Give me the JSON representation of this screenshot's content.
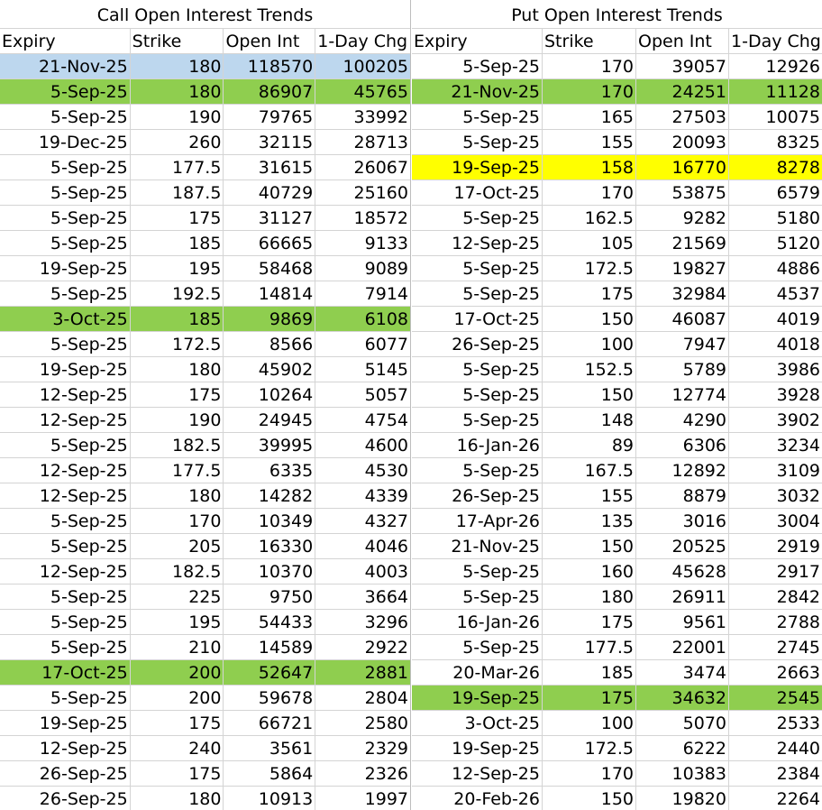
{
  "call": {
    "title": "Call Open Interest Trends",
    "headers": [
      "Expiry",
      "Strike",
      "Open Int",
      "1-Day Chg"
    ],
    "rows": [
      {
        "cells": [
          "21-Nov-25",
          "180",
          "118570",
          "100205"
        ],
        "hl": "blue"
      },
      {
        "cells": [
          "5-Sep-25",
          "180",
          "86907",
          "45765"
        ],
        "hl": "green"
      },
      {
        "cells": [
          "5-Sep-25",
          "190",
          "79765",
          "33992"
        ],
        "hl": ""
      },
      {
        "cells": [
          "19-Dec-25",
          "260",
          "32115",
          "28713"
        ],
        "hl": ""
      },
      {
        "cells": [
          "5-Sep-25",
          "177.5",
          "31615",
          "26067"
        ],
        "hl": ""
      },
      {
        "cells": [
          "5-Sep-25",
          "187.5",
          "40729",
          "25160"
        ],
        "hl": ""
      },
      {
        "cells": [
          "5-Sep-25",
          "175",
          "31127",
          "18572"
        ],
        "hl": ""
      },
      {
        "cells": [
          "5-Sep-25",
          "185",
          "66665",
          "9133"
        ],
        "hl": ""
      },
      {
        "cells": [
          "19-Sep-25",
          "195",
          "58468",
          "9089"
        ],
        "hl": ""
      },
      {
        "cells": [
          "5-Sep-25",
          "192.5",
          "14814",
          "7914"
        ],
        "hl": ""
      },
      {
        "cells": [
          "3-Oct-25",
          "185",
          "9869",
          "6108"
        ],
        "hl": "green"
      },
      {
        "cells": [
          "5-Sep-25",
          "172.5",
          "8566",
          "6077"
        ],
        "hl": ""
      },
      {
        "cells": [
          "19-Sep-25",
          "180",
          "45902",
          "5145"
        ],
        "hl": ""
      },
      {
        "cells": [
          "12-Sep-25",
          "175",
          "10264",
          "5057"
        ],
        "hl": ""
      },
      {
        "cells": [
          "12-Sep-25",
          "190",
          "24945",
          "4754"
        ],
        "hl": ""
      },
      {
        "cells": [
          "5-Sep-25",
          "182.5",
          "39995",
          "4600"
        ],
        "hl": ""
      },
      {
        "cells": [
          "12-Sep-25",
          "177.5",
          "6335",
          "4530"
        ],
        "hl": ""
      },
      {
        "cells": [
          "12-Sep-25",
          "180",
          "14282",
          "4339"
        ],
        "hl": ""
      },
      {
        "cells": [
          "5-Sep-25",
          "170",
          "10349",
          "4327"
        ],
        "hl": ""
      },
      {
        "cells": [
          "5-Sep-25",
          "205",
          "16330",
          "4046"
        ],
        "hl": ""
      },
      {
        "cells": [
          "12-Sep-25",
          "182.5",
          "10370",
          "4003"
        ],
        "hl": ""
      },
      {
        "cells": [
          "5-Sep-25",
          "225",
          "9750",
          "3664"
        ],
        "hl": ""
      },
      {
        "cells": [
          "5-Sep-25",
          "195",
          "54433",
          "3296"
        ],
        "hl": ""
      },
      {
        "cells": [
          "5-Sep-25",
          "210",
          "14589",
          "2922"
        ],
        "hl": ""
      },
      {
        "cells": [
          "17-Oct-25",
          "200",
          "52647",
          "2881"
        ],
        "hl": "green"
      },
      {
        "cells": [
          "5-Sep-25",
          "200",
          "59678",
          "2804"
        ],
        "hl": ""
      },
      {
        "cells": [
          "19-Sep-25",
          "175",
          "66721",
          "2580"
        ],
        "hl": ""
      },
      {
        "cells": [
          "12-Sep-25",
          "240",
          "3561",
          "2329"
        ],
        "hl": ""
      },
      {
        "cells": [
          "26-Sep-25",
          "175",
          "5864",
          "2326"
        ],
        "hl": ""
      },
      {
        "cells": [
          "26-Sep-25",
          "180",
          "10913",
          "1997"
        ],
        "hl": ""
      }
    ]
  },
  "put": {
    "title": "Put Open Interest Trends",
    "headers": [
      "Expiry",
      "Strike",
      "Open Int",
      "1-Day Chg"
    ],
    "rows": [
      {
        "cells": [
          "5-Sep-25",
          "170",
          "39057",
          "12926"
        ],
        "hl": ""
      },
      {
        "cells": [
          "21-Nov-25",
          "170",
          "24251",
          "11128"
        ],
        "hl": "green"
      },
      {
        "cells": [
          "5-Sep-25",
          "165",
          "27503",
          "10075"
        ],
        "hl": ""
      },
      {
        "cells": [
          "5-Sep-25",
          "155",
          "20093",
          "8325"
        ],
        "hl": ""
      },
      {
        "cells": [
          "19-Sep-25",
          "158",
          "16770",
          "8278"
        ],
        "hl": "yellow"
      },
      {
        "cells": [
          "17-Oct-25",
          "170",
          "53875",
          "6579"
        ],
        "hl": ""
      },
      {
        "cells": [
          "5-Sep-25",
          "162.5",
          "9282",
          "5180"
        ],
        "hl": ""
      },
      {
        "cells": [
          "12-Sep-25",
          "105",
          "21569",
          "5120"
        ],
        "hl": ""
      },
      {
        "cells": [
          "5-Sep-25",
          "172.5",
          "19827",
          "4886"
        ],
        "hl": ""
      },
      {
        "cells": [
          "5-Sep-25",
          "175",
          "32984",
          "4537"
        ],
        "hl": ""
      },
      {
        "cells": [
          "17-Oct-25",
          "150",
          "46087",
          "4019"
        ],
        "hl": ""
      },
      {
        "cells": [
          "26-Sep-25",
          "100",
          "7947",
          "4018"
        ],
        "hl": ""
      },
      {
        "cells": [
          "5-Sep-25",
          "152.5",
          "5789",
          "3986"
        ],
        "hl": ""
      },
      {
        "cells": [
          "5-Sep-25",
          "150",
          "12774",
          "3928"
        ],
        "hl": ""
      },
      {
        "cells": [
          "5-Sep-25",
          "148",
          "4290",
          "3902"
        ],
        "hl": ""
      },
      {
        "cells": [
          "16-Jan-26",
          "89",
          "6306",
          "3234"
        ],
        "hl": ""
      },
      {
        "cells": [
          "5-Sep-25",
          "167.5",
          "12892",
          "3109"
        ],
        "hl": ""
      },
      {
        "cells": [
          "26-Sep-25",
          "155",
          "8879",
          "3032"
        ],
        "hl": ""
      },
      {
        "cells": [
          "17-Apr-26",
          "135",
          "3016",
          "3004"
        ],
        "hl": ""
      },
      {
        "cells": [
          "21-Nov-25",
          "150",
          "20525",
          "2919"
        ],
        "hl": ""
      },
      {
        "cells": [
          "5-Sep-25",
          "160",
          "45628",
          "2917"
        ],
        "hl": ""
      },
      {
        "cells": [
          "5-Sep-25",
          "180",
          "26911",
          "2842"
        ],
        "hl": ""
      },
      {
        "cells": [
          "16-Jan-26",
          "175",
          "9561",
          "2788"
        ],
        "hl": ""
      },
      {
        "cells": [
          "5-Sep-25",
          "177.5",
          "22001",
          "2745"
        ],
        "hl": ""
      },
      {
        "cells": [
          "20-Mar-26",
          "185",
          "3474",
          "2663"
        ],
        "hl": ""
      },
      {
        "cells": [
          "19-Sep-25",
          "175",
          "34632",
          "2545"
        ],
        "hl": "green"
      },
      {
        "cells": [
          "3-Oct-25",
          "100",
          "5070",
          "2533"
        ],
        "hl": ""
      },
      {
        "cells": [
          "19-Sep-25",
          "172.5",
          "6222",
          "2440"
        ],
        "hl": ""
      },
      {
        "cells": [
          "12-Sep-25",
          "170",
          "10383",
          "2384"
        ],
        "hl": ""
      },
      {
        "cells": [
          "20-Feb-26",
          "150",
          "19820",
          "2264"
        ],
        "hl": ""
      }
    ]
  },
  "colors": {
    "highlight_blue": "#bdd7ee",
    "highlight_green": "#8fce4f",
    "highlight_yellow": "#ffff00",
    "grid_line": "#d4d4d4"
  }
}
